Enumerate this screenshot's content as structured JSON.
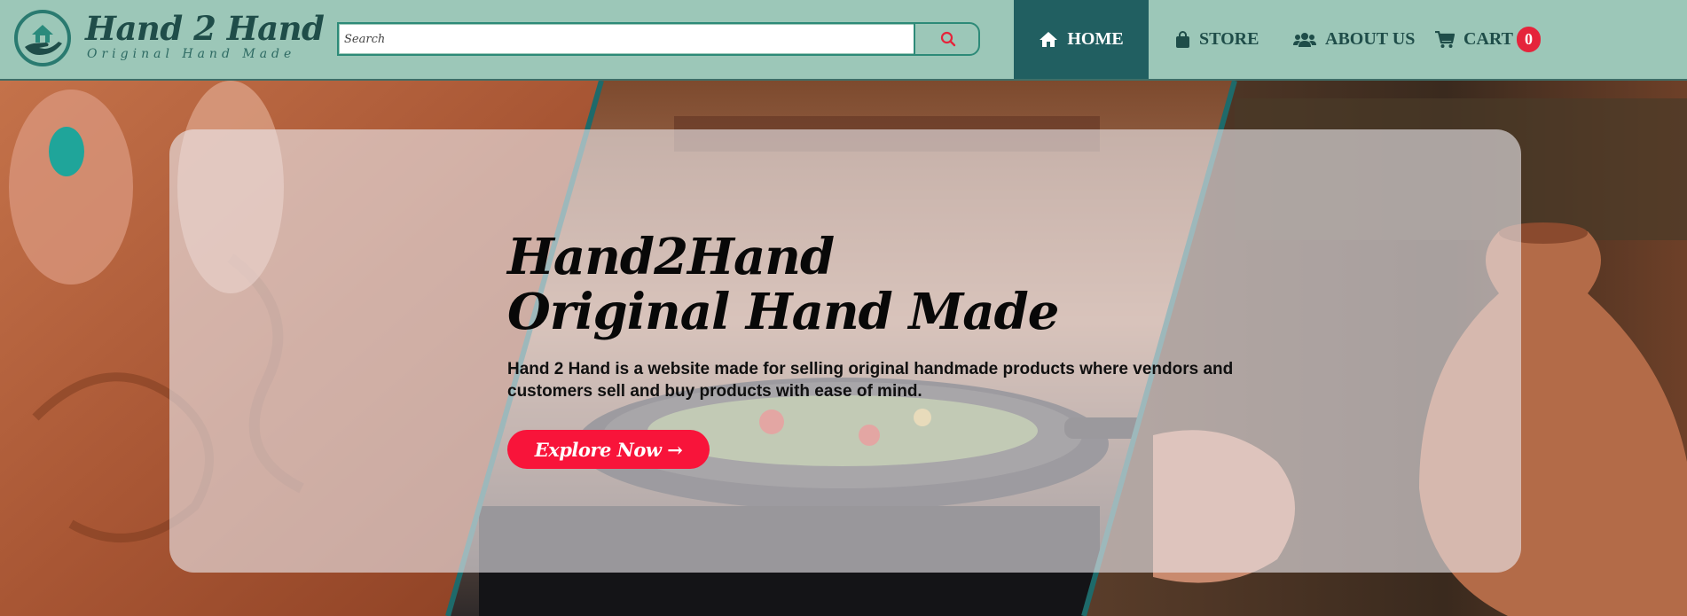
{
  "brand": {
    "name": "Hand 2 Hand",
    "tagline": "Original Hand Made"
  },
  "search": {
    "placeholder": "Search",
    "value": ""
  },
  "nav": {
    "home": "HOME",
    "store": "STORE",
    "about": "ABOUT US",
    "cart": "CART",
    "cart_count": "0",
    "active": "home"
  },
  "hero": {
    "title_line1": "Hand2Hand",
    "title_line2": "Original Hand Made",
    "description": "Hand 2 Hand is a website made for selling original handmade products where vendors and customers sell and buy products with ease of mind.",
    "cta": "Explore Now →"
  },
  "icons": {
    "logo": "home-in-hand-icon",
    "search": "search-icon",
    "home": "home-icon",
    "store": "shopping-bag-icon",
    "about": "users-icon",
    "cart": "shopping-cart-icon"
  },
  "colors": {
    "navbar_bg": "#9cc7b8",
    "brand_dark": "#1f4d49",
    "active_nav_bg": "#215f61",
    "accent_red": "#f8143a",
    "badge_red": "#e5243b",
    "search_border": "#2d8a78"
  }
}
